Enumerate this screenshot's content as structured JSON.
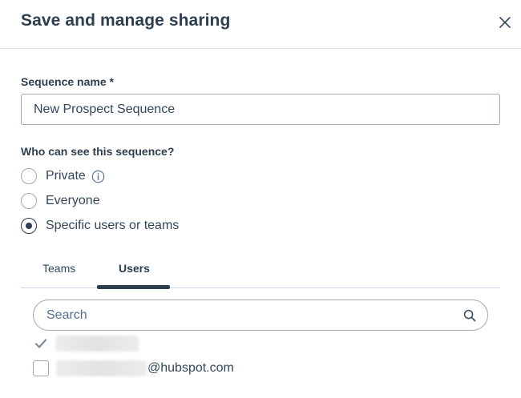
{
  "dialog": {
    "title": "Save and manage sharing",
    "close_icon": "close-icon"
  },
  "sequence_name": {
    "label": "Sequence name *",
    "value": "New Prospect Sequence"
  },
  "visibility": {
    "label": "Who can see this sequence?",
    "selected": "Specific users or teams",
    "options": [
      {
        "label": "Private",
        "checked": false,
        "icon": "info-icon"
      },
      {
        "label": "Everyone",
        "checked": false
      },
      {
        "label": "Specific users or teams",
        "checked": true
      }
    ]
  },
  "tabs": {
    "items": [
      {
        "label": "Teams",
        "active": false
      },
      {
        "label": "Users",
        "active": true
      }
    ]
  },
  "search": {
    "placeholder": "Search",
    "value": "",
    "icon": "search-icon"
  },
  "users": [
    {
      "name_redacted": true,
      "email_suffix": "",
      "checked": true,
      "disabled": true
    },
    {
      "name_redacted": true,
      "email_suffix": "@hubspot.com",
      "checked": false,
      "disabled": false
    }
  ],
  "colors": {
    "text_dark": "#2d3e50",
    "text_body": "#33475b",
    "border": "#9fa9b5",
    "divider": "#dfe3eb"
  }
}
